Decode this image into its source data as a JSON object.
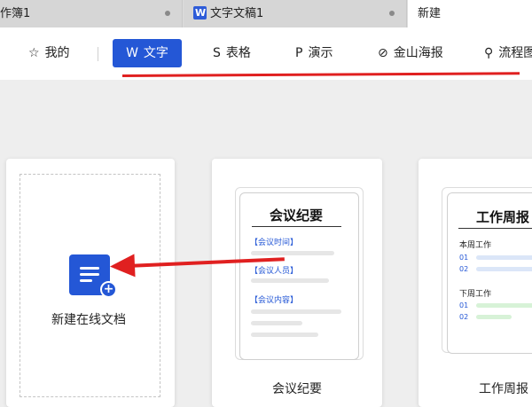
{
  "tabs": [
    {
      "title": "作簿1"
    },
    {
      "title": "文字文稿1",
      "icon": "wps-writer-icon"
    },
    {
      "title": "新建"
    }
  ],
  "categories": {
    "mine": "我的",
    "text": "文字",
    "sheet": "表格",
    "slide": "演示",
    "poster": "金山海报",
    "flow": "流程图"
  },
  "new_doc": {
    "label": "新建在线文档"
  },
  "templates": {
    "meeting": {
      "paper_title": "会议纪要",
      "fields": [
        "【会议时间】",
        "【会议人员】",
        "【会议内容】"
      ],
      "caption": "会议纪要"
    },
    "weekly": {
      "paper_title": "工作周报",
      "this_week": "本周工作",
      "next_week": "下周工作",
      "nums": [
        "01",
        "02",
        "01",
        "02"
      ],
      "caption": "工作周报"
    }
  },
  "colors": {
    "accent": "#2457d6",
    "annotation": "#e02020"
  }
}
